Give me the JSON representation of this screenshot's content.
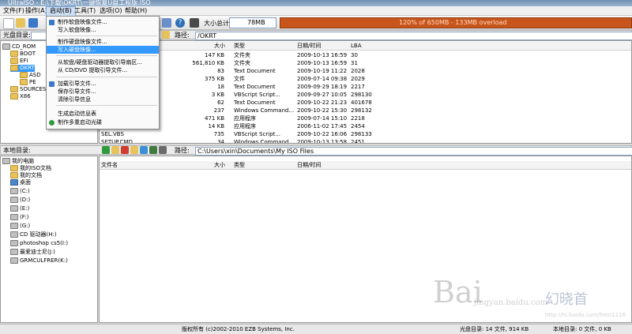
{
  "window": {
    "title": "UltraISO - E:\\下载\\OKRT\\一键恢复U盘工程版.ISO"
  },
  "menu": [
    {
      "label": "文件(F)"
    },
    {
      "label": "操作(A)"
    },
    {
      "label": "启动(B)"
    },
    {
      "label": "工具(T)"
    },
    {
      "label": "选项(O)"
    },
    {
      "label": "帮助(H)"
    }
  ],
  "toolbar": {
    "size_label": "大小总计:",
    "size_value": "78MB",
    "progress_text": "120% of 650MB - 133MB overload",
    "progress_fraction": 1.0
  },
  "iso_pane": {
    "dir_label": "光盘目录:",
    "path_label": "路径:",
    "path_value": "/OKRT",
    "tree": [
      "CD_ROM",
      "BOOT",
      "EFI",
      "OKRT",
      "ASD",
      "PE",
      "SOURCES",
      "X86"
    ],
    "headers": [
      "大小",
      "类型",
      "日期/时间",
      "LBA"
    ],
    "files": [
      {
        "name": "",
        "size": "147 KB",
        "type": "文件夹",
        "date": "2009-10-13 16:59",
        "lba": "30"
      },
      {
        "name": "",
        "size": "561,810 KB",
        "type": "文件夹",
        "date": "2009-10-13 16:59",
        "lba": "31"
      },
      {
        "name": "",
        "size": "83",
        "type": "Text Document",
        "date": "2009-10-19 11:22",
        "lba": "2028"
      },
      {
        "name": "",
        "size": "375 KB",
        "type": "文件",
        "date": "2009-07-14 09:38",
        "lba": "2029"
      },
      {
        "name": "",
        "size": "18",
        "type": "Text Document",
        "date": "2009-09-29 18:19",
        "lba": "2217"
      },
      {
        "name": "",
        "size": "3 KB",
        "type": "VBScript Script...",
        "date": "2009-09-27 10:05",
        "lba": "298130"
      },
      {
        "name": "",
        "size": "62",
        "type": "Text Document",
        "date": "2009-10-22 21:23",
        "lba": "401678"
      },
      {
        "name": "",
        "size": "237",
        "type": "Windows Command...",
        "date": "2009-10-22 15:30",
        "lba": "298132"
      },
      {
        "name": "",
        "size": "471 KB",
        "type": "应用程序",
        "date": "2009-07-14 15:10",
        "lba": "2218"
      },
      {
        "name": "",
        "size": "14 KB",
        "type": "应用程序",
        "date": "2006-11-02 17:45",
        "lba": "2454"
      },
      {
        "name": "SEL.VBS",
        "size": "735",
        "type": "VBScript Script...",
        "date": "2009-10-22 16:06",
        "lba": "298133"
      },
      {
        "name": "SETUP.CMD",
        "size": "34",
        "type": "Windows Command...",
        "date": "2009-10-13 13:58",
        "lba": "2451"
      }
    ]
  },
  "boot_menu": [
    {
      "label": "制作软盘映像文件...",
      "icon": "floppy"
    },
    {
      "label": "写入软盘映像...",
      "icon": ""
    },
    {
      "label": "制作硬盘映像文件...",
      "icon": ""
    },
    {
      "label": "写入硬盘映像...",
      "icon": "",
      "highlighted": true
    },
    {
      "label": "从软盘/硬盘驱动器提取引导扇区...",
      "icon": ""
    },
    {
      "label": "从 CD/DVD 提取引导文件...",
      "icon": ""
    },
    {
      "label": "加载引导文件...",
      "icon": "load"
    },
    {
      "label": "保存引导文件...",
      "icon": ""
    },
    {
      "label": "清除引导信息",
      "icon": ""
    },
    {
      "label": "生成启动信息表",
      "icon": ""
    },
    {
      "label": "制作多重启动光碟",
      "icon": "multiboot"
    }
  ],
  "local_pane": {
    "dir_label": "本地目录:",
    "path_label": "路径:",
    "path_value": "C:\\Users\\xin\\Documents\\My ISO Files",
    "tree": [
      "我的电脑",
      "我的ISO文档",
      "我的文档",
      "桌面",
      "(C:)",
      "(D:)",
      "(E:)",
      "(F:)",
      "(G:)",
      "CD 驱动器(H:)",
      "photoshop cs5(I:)",
      "最爱迪士尼(J:)",
      "GRMCULFRER(K:)"
    ],
    "headers": [
      "文件名",
      "大小",
      "类型",
      "日期/时间"
    ]
  },
  "status": {
    "copyright": "版权所有 (c)2002-2010 EZB Systems, Inc.",
    "iso_status": "光盘目录: 14 文件, 914 KB",
    "local_status": "本地目录: 0 文件, 0 KB"
  },
  "watermark": {
    "brand": "Bai",
    "sub": "jingyan.baidu.com",
    "url": "http://hi.baidu.com/hein1116",
    "logo": "幻晓首"
  },
  "colors": {
    "progress": "#c8551b",
    "highlight": "#3399ff"
  }
}
